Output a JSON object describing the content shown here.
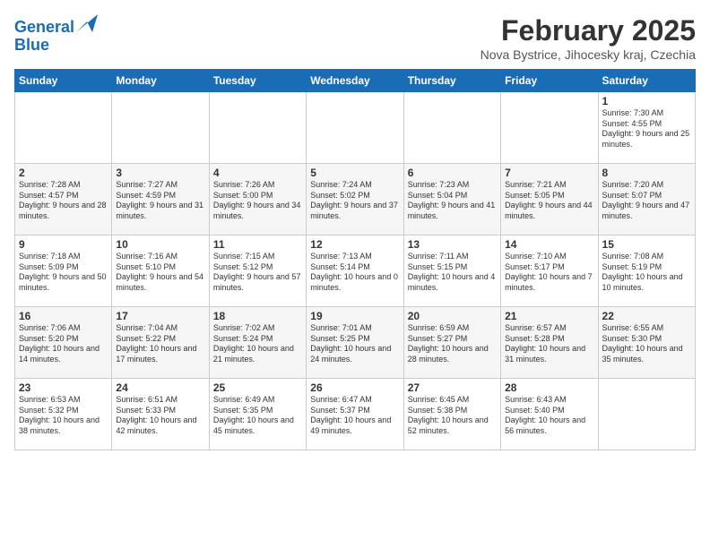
{
  "header": {
    "logo_line1": "General",
    "logo_line2": "Blue",
    "title": "February 2025",
    "subtitle": "Nova Bystrice, Jihocesky kraj, Czechia"
  },
  "days_of_week": [
    "Sunday",
    "Monday",
    "Tuesday",
    "Wednesday",
    "Thursday",
    "Friday",
    "Saturday"
  ],
  "weeks": [
    [
      {
        "day": "",
        "info": ""
      },
      {
        "day": "",
        "info": ""
      },
      {
        "day": "",
        "info": ""
      },
      {
        "day": "",
        "info": ""
      },
      {
        "day": "",
        "info": ""
      },
      {
        "day": "",
        "info": ""
      },
      {
        "day": "1",
        "info": "Sunrise: 7:30 AM\nSunset: 4:55 PM\nDaylight: 9 hours and 25 minutes."
      }
    ],
    [
      {
        "day": "2",
        "info": "Sunrise: 7:28 AM\nSunset: 4:57 PM\nDaylight: 9 hours and 28 minutes."
      },
      {
        "day": "3",
        "info": "Sunrise: 7:27 AM\nSunset: 4:59 PM\nDaylight: 9 hours and 31 minutes."
      },
      {
        "day": "4",
        "info": "Sunrise: 7:26 AM\nSunset: 5:00 PM\nDaylight: 9 hours and 34 minutes."
      },
      {
        "day": "5",
        "info": "Sunrise: 7:24 AM\nSunset: 5:02 PM\nDaylight: 9 hours and 37 minutes."
      },
      {
        "day": "6",
        "info": "Sunrise: 7:23 AM\nSunset: 5:04 PM\nDaylight: 9 hours and 41 minutes."
      },
      {
        "day": "7",
        "info": "Sunrise: 7:21 AM\nSunset: 5:05 PM\nDaylight: 9 hours and 44 minutes."
      },
      {
        "day": "8",
        "info": "Sunrise: 7:20 AM\nSunset: 5:07 PM\nDaylight: 9 hours and 47 minutes."
      }
    ],
    [
      {
        "day": "9",
        "info": "Sunrise: 7:18 AM\nSunset: 5:09 PM\nDaylight: 9 hours and 50 minutes."
      },
      {
        "day": "10",
        "info": "Sunrise: 7:16 AM\nSunset: 5:10 PM\nDaylight: 9 hours and 54 minutes."
      },
      {
        "day": "11",
        "info": "Sunrise: 7:15 AM\nSunset: 5:12 PM\nDaylight: 9 hours and 57 minutes."
      },
      {
        "day": "12",
        "info": "Sunrise: 7:13 AM\nSunset: 5:14 PM\nDaylight: 10 hours and 0 minutes."
      },
      {
        "day": "13",
        "info": "Sunrise: 7:11 AM\nSunset: 5:15 PM\nDaylight: 10 hours and 4 minutes."
      },
      {
        "day": "14",
        "info": "Sunrise: 7:10 AM\nSunset: 5:17 PM\nDaylight: 10 hours and 7 minutes."
      },
      {
        "day": "15",
        "info": "Sunrise: 7:08 AM\nSunset: 5:19 PM\nDaylight: 10 hours and 10 minutes."
      }
    ],
    [
      {
        "day": "16",
        "info": "Sunrise: 7:06 AM\nSunset: 5:20 PM\nDaylight: 10 hours and 14 minutes."
      },
      {
        "day": "17",
        "info": "Sunrise: 7:04 AM\nSunset: 5:22 PM\nDaylight: 10 hours and 17 minutes."
      },
      {
        "day": "18",
        "info": "Sunrise: 7:02 AM\nSunset: 5:24 PM\nDaylight: 10 hours and 21 minutes."
      },
      {
        "day": "19",
        "info": "Sunrise: 7:01 AM\nSunset: 5:25 PM\nDaylight: 10 hours and 24 minutes."
      },
      {
        "day": "20",
        "info": "Sunrise: 6:59 AM\nSunset: 5:27 PM\nDaylight: 10 hours and 28 minutes."
      },
      {
        "day": "21",
        "info": "Sunrise: 6:57 AM\nSunset: 5:28 PM\nDaylight: 10 hours and 31 minutes."
      },
      {
        "day": "22",
        "info": "Sunrise: 6:55 AM\nSunset: 5:30 PM\nDaylight: 10 hours and 35 minutes."
      }
    ],
    [
      {
        "day": "23",
        "info": "Sunrise: 6:53 AM\nSunset: 5:32 PM\nDaylight: 10 hours and 38 minutes."
      },
      {
        "day": "24",
        "info": "Sunrise: 6:51 AM\nSunset: 5:33 PM\nDaylight: 10 hours and 42 minutes."
      },
      {
        "day": "25",
        "info": "Sunrise: 6:49 AM\nSunset: 5:35 PM\nDaylight: 10 hours and 45 minutes."
      },
      {
        "day": "26",
        "info": "Sunrise: 6:47 AM\nSunset: 5:37 PM\nDaylight: 10 hours and 49 minutes."
      },
      {
        "day": "27",
        "info": "Sunrise: 6:45 AM\nSunset: 5:38 PM\nDaylight: 10 hours and 52 minutes."
      },
      {
        "day": "28",
        "info": "Sunrise: 6:43 AM\nSunset: 5:40 PM\nDaylight: 10 hours and 56 minutes."
      },
      {
        "day": "",
        "info": ""
      }
    ]
  ]
}
